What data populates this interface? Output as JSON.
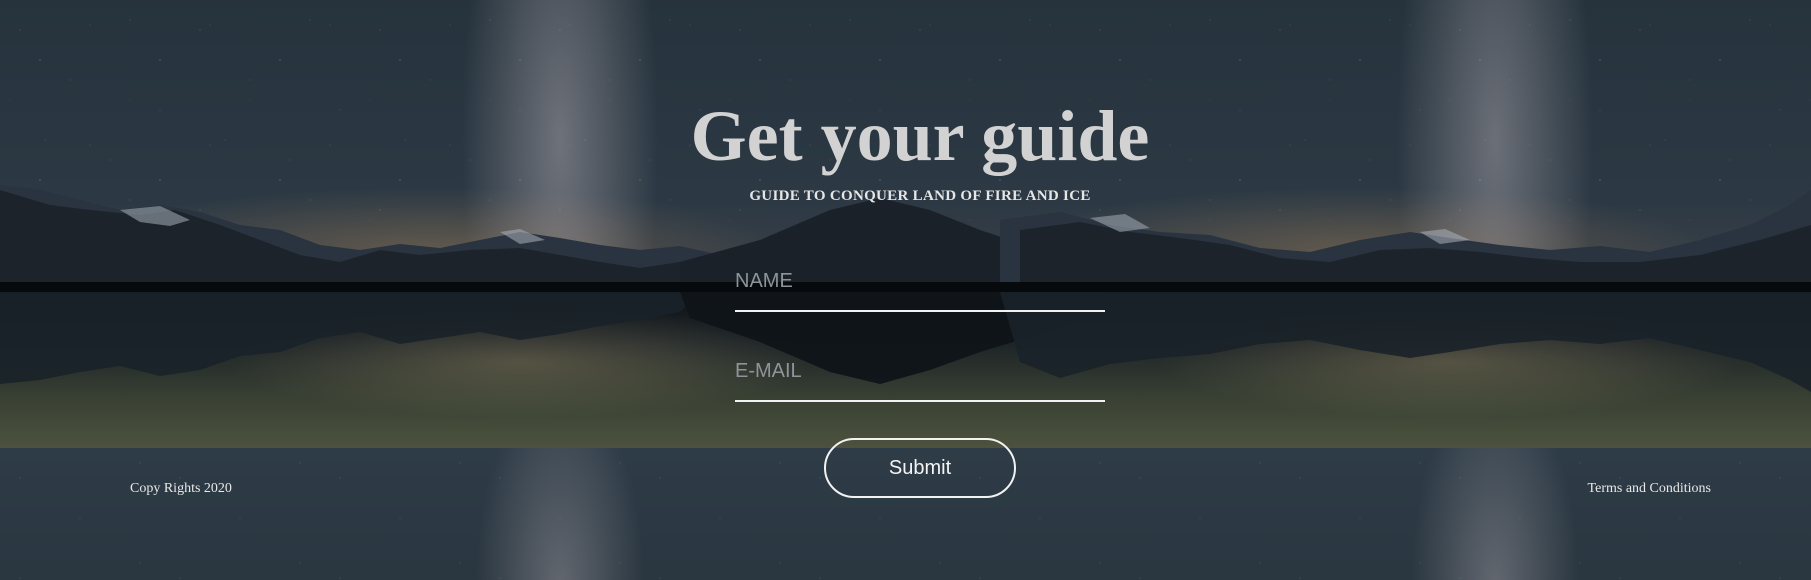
{
  "hero": {
    "title": "Get your guide",
    "subtitle": "GUIDE TO CONQUER LAND OF FIRE AND ICE"
  },
  "form": {
    "name_placeholder": "NAME",
    "email_placeholder": "E-MAIL",
    "submit_label": "Submit"
  },
  "footer": {
    "copyright": "Copy Rights 2020",
    "terms_link": "Terms and Conditions"
  },
  "colors": {
    "text_primary": "#d2d2d2",
    "text_light": "#f2f2f2",
    "placeholder": "#8d949a",
    "sky_dark": "#26333d",
    "lake_dark": "#0e1317"
  }
}
